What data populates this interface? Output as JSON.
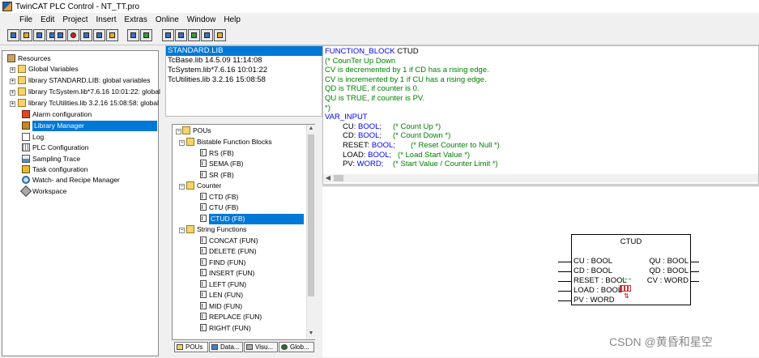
{
  "window": {
    "title": "TwinCAT PLC Control - NT_TT.pro"
  },
  "menu": [
    "File",
    "Edit",
    "Project",
    "Insert",
    "Extras",
    "Online",
    "Window",
    "Help"
  ],
  "resources": {
    "root": "Resources",
    "items": [
      "Global Variables",
      "library STANDARD.LIB: global variables",
      "library TcSystem.lib*7.6.16 10:01:22: global",
      "library TcUtilities.lib 3.2.16 15:08:58: global",
      "Alarm configuration",
      "Library Manager",
      "Log",
      "PLC Configuration",
      "Sampling Trace",
      "Task configuration",
      "Watch- and Recipe Manager",
      "Workspace"
    ]
  },
  "libraries": [
    "STANDARD.LIB",
    "TcBase.lib 14.5.09 11:14:08",
    "TcSystem.lib*7.6.16 10:01:22",
    "TcUtilities.lib 3.2.16 15:08:58"
  ],
  "pou_tree": {
    "root": "POUs",
    "groups": [
      {
        "name": "Bistable Function Blocks",
        "items": [
          "RS (FB)",
          "SEMA (FB)",
          "SR (FB)"
        ]
      },
      {
        "name": "Counter",
        "items": [
          "CTD (FB)",
          "CTU (FB)",
          "CTUD (FB)"
        ]
      },
      {
        "name": "String Functions",
        "items": [
          "CONCAT (FUN)",
          "DELETE (FUN)",
          "FIND (FUN)",
          "INSERT (FUN)",
          "LEFT (FUN)",
          "LEN (FUN)",
          "MID (FUN)",
          "REPLACE (FUN)",
          "RIGHT (FUN)"
        ]
      }
    ]
  },
  "bottom_tabs": [
    "POUs",
    "Data...",
    "Visu...",
    "Glob..."
  ],
  "code": {
    "l1_kw": "FUNCTION_BLOCK",
    "l1_name": " CTUD",
    "comments": [
      "(* CounTer Up Down",
      "CV is decremented by 1 if CD has a rising edge.",
      "CV is incremented by 1 if CU has a rising edge.",
      "QD is TRUE, if counter is 0.",
      "QU is TRUE, if counter is PV.",
      "*)"
    ],
    "var_input": "VAR_INPUT",
    "vars": [
      {
        "name": "CU: ",
        "type": "BOOL;",
        "comment": "(* Count Up *)"
      },
      {
        "name": "CD: ",
        "type": "BOOL;",
        "comment": "(* Count Down *)"
      },
      {
        "name": "RESET: ",
        "type": "BOOL;",
        "comment": "(* Reset Counter to Null *)"
      },
      {
        "name": "LOAD: ",
        "type": "BOOL;",
        "comment": "(* Load Start Value *)"
      },
      {
        "name": "PV: ",
        "type": "WORD;",
        "comment": "(* Start Value / Counter Limit *)"
      }
    ]
  },
  "fb": {
    "title": "CTUD",
    "inputs": [
      "CU : BOOL",
      "CD : BOOL",
      "RESET : BOOL",
      "LOAD : BOOL",
      "PV : WORD"
    ],
    "outputs": [
      "QU : BOOL",
      "QD : BOOL",
      "CV : WORD"
    ]
  },
  "watermark": "CSDN @黄昏和星空",
  "colors": {
    "selection": "#0078d7",
    "keyword": "#0000ff",
    "comment": "#008000"
  }
}
